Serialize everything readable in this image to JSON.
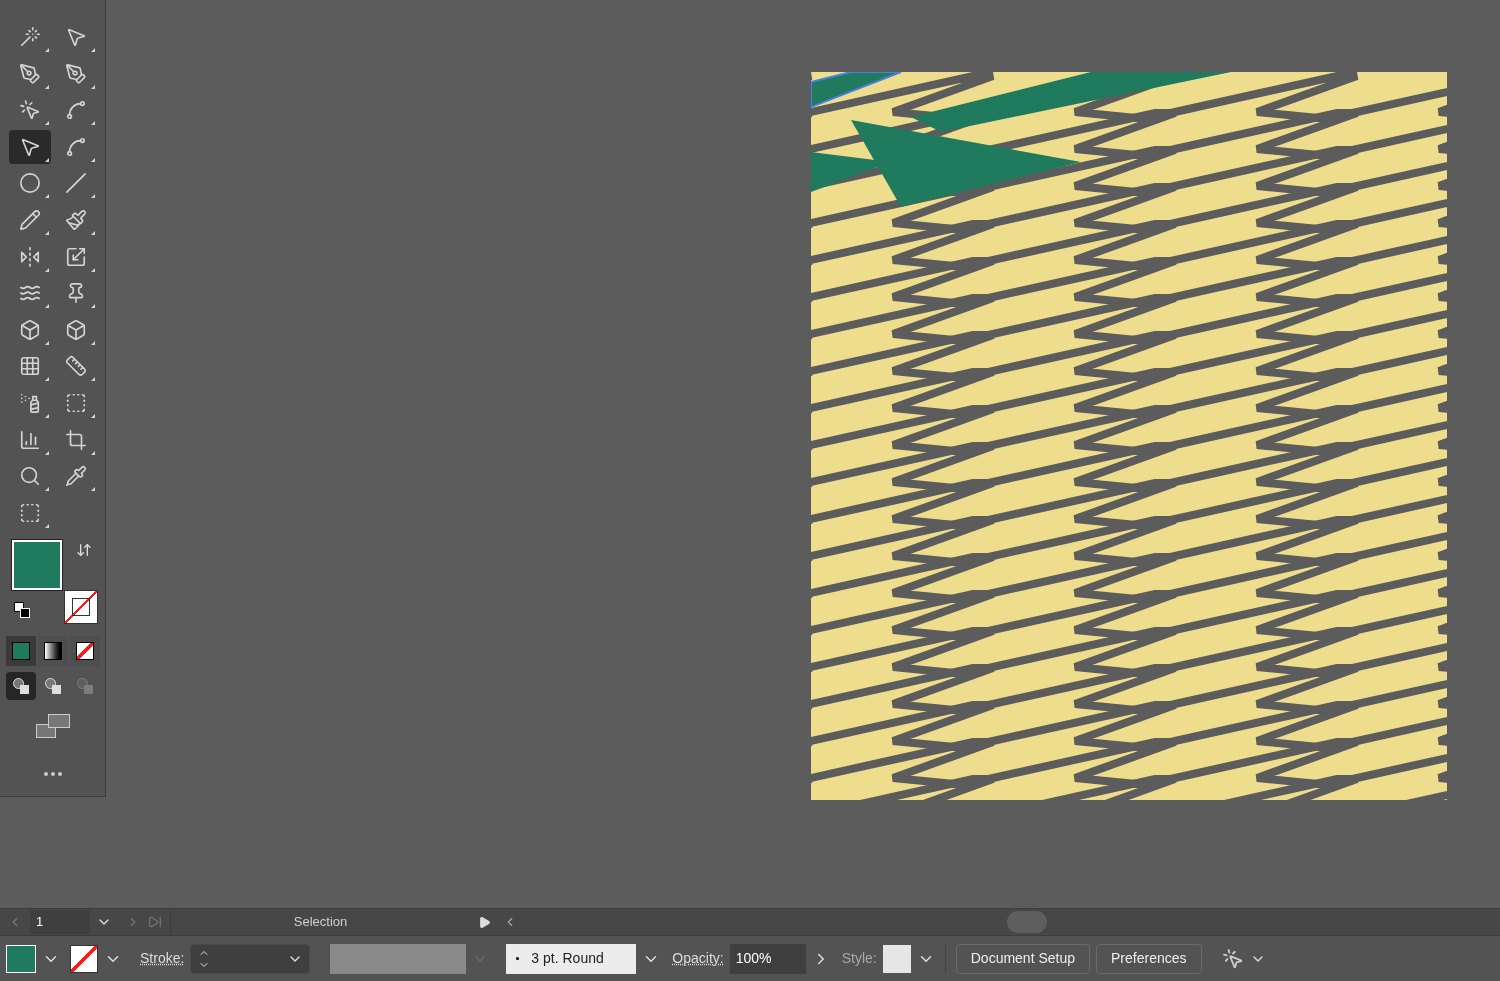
{
  "tools_panel": {
    "tools": [
      {
        "kind": "magic-wand",
        "selected": false
      },
      {
        "kind": "selection",
        "selected": false
      },
      {
        "kind": "pen-add",
        "selected": false
      },
      {
        "kind": "pen-delete",
        "selected": false
      },
      {
        "kind": "arrow-add",
        "selected": false
      },
      {
        "kind": "curvature",
        "selected": false
      },
      {
        "kind": "direct-selection",
        "selected": true
      },
      {
        "kind": "arc",
        "selected": false
      },
      {
        "kind": "ellipse",
        "selected": false
      },
      {
        "kind": "line",
        "selected": false
      },
      {
        "kind": "pencil",
        "selected": false
      },
      {
        "kind": "brush",
        "selected": false
      },
      {
        "kind": "reflect",
        "selected": false
      },
      {
        "kind": "scale",
        "selected": false
      },
      {
        "kind": "warp",
        "selected": false
      },
      {
        "kind": "pin",
        "selected": false
      },
      {
        "kind": "shape-builder",
        "selected": false
      },
      {
        "kind": "perspective",
        "selected": false
      },
      {
        "kind": "mesh",
        "selected": false
      },
      {
        "kind": "ruler",
        "selected": false
      },
      {
        "kind": "spray",
        "selected": false
      },
      {
        "kind": "frame",
        "selected": false
      },
      {
        "kind": "chart",
        "selected": false
      },
      {
        "kind": "crop",
        "selected": false
      },
      {
        "kind": "zoom",
        "selected": false
      },
      {
        "kind": "eyedropper",
        "selected": false
      },
      {
        "kind": "artboard",
        "selected": false
      }
    ]
  },
  "fill": {
    "color": "#1f7a5e"
  },
  "stroke": {
    "none": true
  },
  "color_modes": [
    {
      "kind": "color",
      "selected": true
    },
    {
      "kind": "gradient",
      "selected": false
    },
    {
      "kind": "none",
      "selected": false
    }
  ],
  "draw_modes": [
    {
      "kind": "normal",
      "selected": true
    },
    {
      "kind": "behind",
      "selected": false
    },
    {
      "kind": "inside",
      "selected": false
    }
  ],
  "status_bar": {
    "artboard": "1",
    "status": "Selection"
  },
  "control_bar": {
    "stroke_label": "Stroke:",
    "brush": "3 pt. Round",
    "opacity_label": "Opacity:",
    "opacity": "100%",
    "style_label": "Style:",
    "buttons": [
      "Document Setup",
      "Preferences"
    ]
  }
}
